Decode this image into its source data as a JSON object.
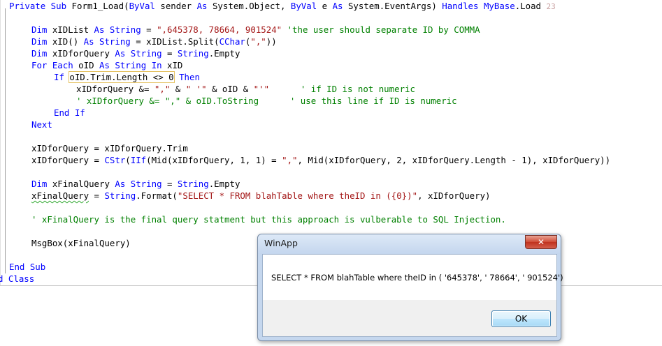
{
  "code": {
    "line1": {
      "kw_private_sub": "Private Sub",
      "name": " Form1_Load(",
      "kw_byval1": "ByVal",
      "p1": " sender ",
      "kw_as1": "As",
      "p2": " System.Object, ",
      "kw_byval2": "ByVal",
      "p3": " e ",
      "kw_as2": "As",
      "p4": " System.EventArgs) ",
      "kw_handles": "Handles",
      "p5": " ",
      "kw_mybase": "MyBase",
      "p6": ".Load ",
      "refcount": "23"
    },
    "line2": {
      "kw_dim": "Dim",
      "p1": " xIDList ",
      "kw_as": "As",
      "p2": " ",
      "kw_string": "String",
      "p3": " = ",
      "str": "\",645378, 78664, 901524\"",
      "p4": " ",
      "comment": "'the user should separate ID by COMMA"
    },
    "line3": {
      "kw_dim": "Dim",
      "p1": " xID() ",
      "kw_as": "As",
      "p2": " ",
      "kw_string": "String",
      "p3": " = xIDList.Split(",
      "kw_cchar": "CChar",
      "p4": "(",
      "str": "\",\"",
      "p5": "))"
    },
    "line4": {
      "kw_dim": "Dim",
      "p1": " xIDforQuery ",
      "kw_as": "As",
      "p2": " ",
      "kw_string": "String",
      "p3": " = ",
      "kw_string2": "String",
      "p4": ".Empty"
    },
    "line5": {
      "kw_for_each": "For Each",
      "p1": " oID ",
      "kw_as": "As",
      "p2": " ",
      "kw_string": "String",
      "p3": " ",
      "kw_in": "In",
      "p4": " xID"
    },
    "line6": {
      "kw_if": "If",
      "p1": " ",
      "hl": "oID.Trim.Length <> 0",
      "p2": " ",
      "kw_then": "Then"
    },
    "line7": {
      "p1": "xIDforQuery &= ",
      "str1": "\",\"",
      "p2": " & ",
      "str2": "\" '\"",
      "p3": " & oID & ",
      "str3": "\"'\"",
      "p4": "      ",
      "comment": "' if ID is not numeric"
    },
    "line8": {
      "comment1": "' xIDforQuery &= \",\" & oID.ToString",
      "p1": "      ",
      "comment2": "' use this line if ID is numeric"
    },
    "line9": {
      "kw_end_if": "End If"
    },
    "line10": {
      "kw_next": "Next"
    },
    "line11": {
      "p1": "xIDforQuery = xIDforQuery.Trim"
    },
    "line12": {
      "p1": "xIDforQuery = ",
      "kw_cstr": "CStr",
      "p2": "(",
      "kw_iif": "IIf",
      "p3": "(Mid(xIDforQuery, 1, 1) = ",
      "str": "\",\"",
      "p4": ", Mid(xIDforQuery, 2, xIDforQuery.Length - 1), xIDforQuery))"
    },
    "line13": {
      "kw_dim": "Dim",
      "p1": " xFinalQuery ",
      "kw_as": "As",
      "p2": " ",
      "kw_string": "String",
      "p3": " = ",
      "kw_string2": "String",
      "p4": ".Empty"
    },
    "line14": {
      "p1": "xFinalQuery",
      "p2": " = ",
      "kw_string": "String",
      "p3": ".Format(",
      "str": "\"SELECT * FROM blahTable where theID in ({0})\"",
      "p4": ", xIDforQuery)"
    },
    "line15": {
      "comment": "' xFinalQuery is the final query statment but this approach is vulberable to SQL Injection."
    },
    "line16": {
      "p1": "MsgBox(xFinalQuery)"
    },
    "line17": {
      "kw_end_sub": "End Sub"
    },
    "line18": {
      "p1": "d ",
      "kw_class": "Class"
    }
  },
  "dialog": {
    "title": "WinApp",
    "close_glyph": "✕",
    "message": "SELECT * FROM blahTable where theID in ( '645378', ' 78664', ' 901524')",
    "ok_label": "OK"
  },
  "colors": {
    "keyword": "#0000ff",
    "comment": "#008000",
    "string": "#a31515",
    "dialog_frame": "#c5d7ee"
  }
}
